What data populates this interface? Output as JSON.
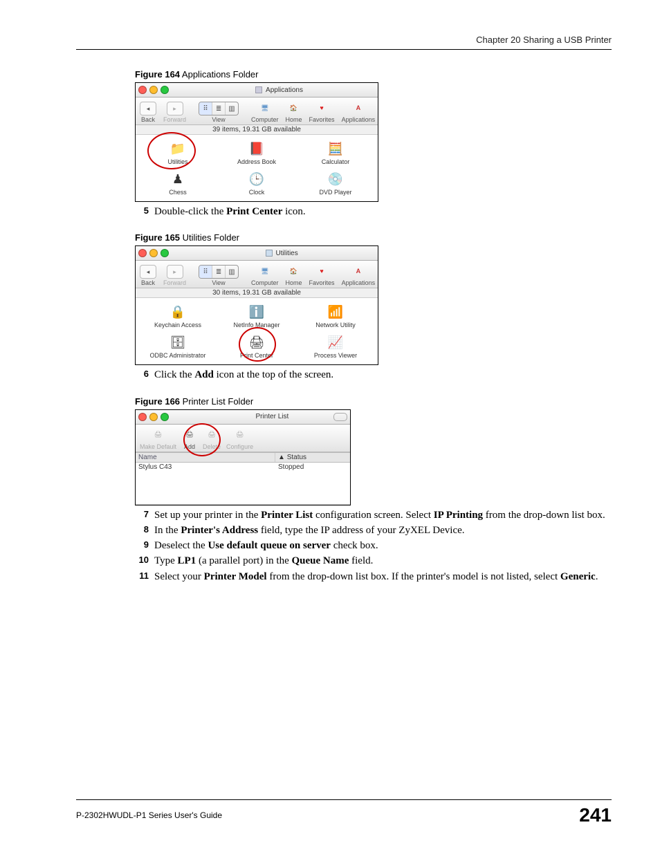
{
  "header": {
    "chapter": "Chapter 20 Sharing a USB Printer"
  },
  "fig164": {
    "caption_bold": "Figure 164",
    "caption_rest": "   Applications Folder",
    "title": "Applications",
    "back": "Back",
    "forward": "Forward",
    "view": "View",
    "computer": "Computer",
    "home": "Home",
    "favorites": "Favorites",
    "applications": "Applications",
    "status": "39 items, 19.31 GB available",
    "utilities": "Utilities",
    "addressbook": "Address Book",
    "calculator": "Calculator",
    "chess": "Chess",
    "clock": "Clock",
    "dvdplayer": "DVD Player"
  },
  "step5": {
    "num": "5",
    "pre": "Double-click the ",
    "bold": "Print Center",
    "post": " icon."
  },
  "fig165": {
    "caption_bold": "Figure 165",
    "caption_rest": "   Utilities Folder",
    "title": "Utilities",
    "back": "Back",
    "forward": "Forward",
    "view": "View",
    "computer": "Computer",
    "home": "Home",
    "favorites": "Favorites",
    "applications": "Applications",
    "status": "30 items, 19.31 GB available",
    "keychain": "Keychain Access",
    "netinfo": "NetInfo Manager",
    "netutil": "Network Utility",
    "odbc": "ODBC Administrator",
    "printcenter": "Print Center",
    "procview": "Process Viewer"
  },
  "step6": {
    "num": "6",
    "pre": "Click the ",
    "bold": "Add",
    "post": " icon at the top of the screen."
  },
  "fig166": {
    "caption_bold": "Figure 166",
    "caption_rest": "   Printer List Folder",
    "title": "Printer List",
    "makedefault": "Make Default",
    "add": "Add",
    "delete": "Delete",
    "configure": "Configure",
    "col_name": "Name",
    "col_status": "Status",
    "row_name": "Stylus C43",
    "row_status": "Stopped"
  },
  "step7": {
    "num": "7",
    "t1": "Set up your printer in the ",
    "b1": "Printer List",
    "t2": " configuration screen. Select ",
    "b2": "IP Printing",
    "t3": " from the drop-down list box."
  },
  "step8": {
    "num": "8",
    "t1": "In the ",
    "b1": "Printer's Address",
    "t2": " field, type the IP address of your ZyXEL Device."
  },
  "step9": {
    "num": "9",
    "t1": "Deselect the ",
    "b1": "Use default queue on server",
    "t2": " check box."
  },
  "step10": {
    "num": "10",
    "t1": "Type ",
    "b1": "LP1",
    "t2": " (a parallel port) in the ",
    "b2": "Queue Name",
    "t3": " field."
  },
  "step11": {
    "num": "11",
    "t1": "Select your ",
    "b1": "Printer Model",
    "t2": " from the drop-down list box. If the printer's model is not listed, select ",
    "b2": "Generic",
    "t3": "."
  },
  "footer": {
    "guide": "P-2302HWUDL-P1 Series User's Guide",
    "page": "241"
  }
}
